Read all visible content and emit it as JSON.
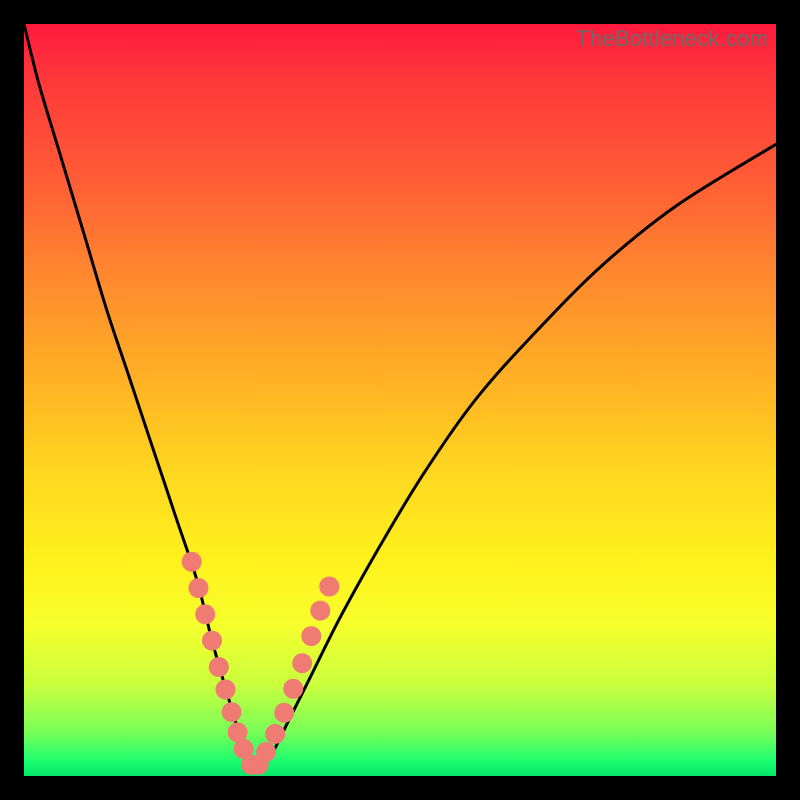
{
  "watermark": "TheBottleneck.com",
  "colors": {
    "frame": "#000000",
    "dot": "#ef7b72",
    "curve": "#000000"
  },
  "chart_data": {
    "type": "line",
    "title": "",
    "xlabel": "",
    "ylabel": "",
    "xlim": [
      0,
      100
    ],
    "ylim": [
      0,
      100
    ],
    "grid": false,
    "legend": "none",
    "series": [
      {
        "name": "bottleneck-curve",
        "x": [
          0,
          2,
          5,
          8,
          11,
          14,
          17,
          20,
          23,
          25,
          27,
          28.5,
          29.5,
          30.5,
          31.5,
          33,
          35,
          38,
          42,
          47,
          53,
          60,
          68,
          77,
          87,
          100
        ],
        "y": [
          100,
          92,
          82,
          72,
          62,
          53,
          44,
          35,
          26,
          18,
          11,
          6,
          3,
          1.2,
          1.2,
          3,
          7,
          13,
          21,
          30,
          40,
          50,
          59,
          68,
          76,
          84
        ]
      }
    ],
    "dots": {
      "name": "highlight-points",
      "x": [
        22.3,
        23.2,
        24.1,
        25.0,
        25.9,
        26.8,
        27.6,
        28.4,
        29.2,
        30.2,
        31.2,
        32.2,
        33.4,
        34.6,
        35.8,
        37.0,
        38.2,
        39.4,
        40.6
      ],
      "y": [
        28.5,
        25.0,
        21.5,
        18.0,
        14.5,
        11.5,
        8.5,
        5.8,
        3.6,
        1.5,
        1.5,
        3.2,
        5.6,
        8.4,
        11.6,
        15.0,
        18.6,
        22.0,
        25.2
      ]
    }
  }
}
